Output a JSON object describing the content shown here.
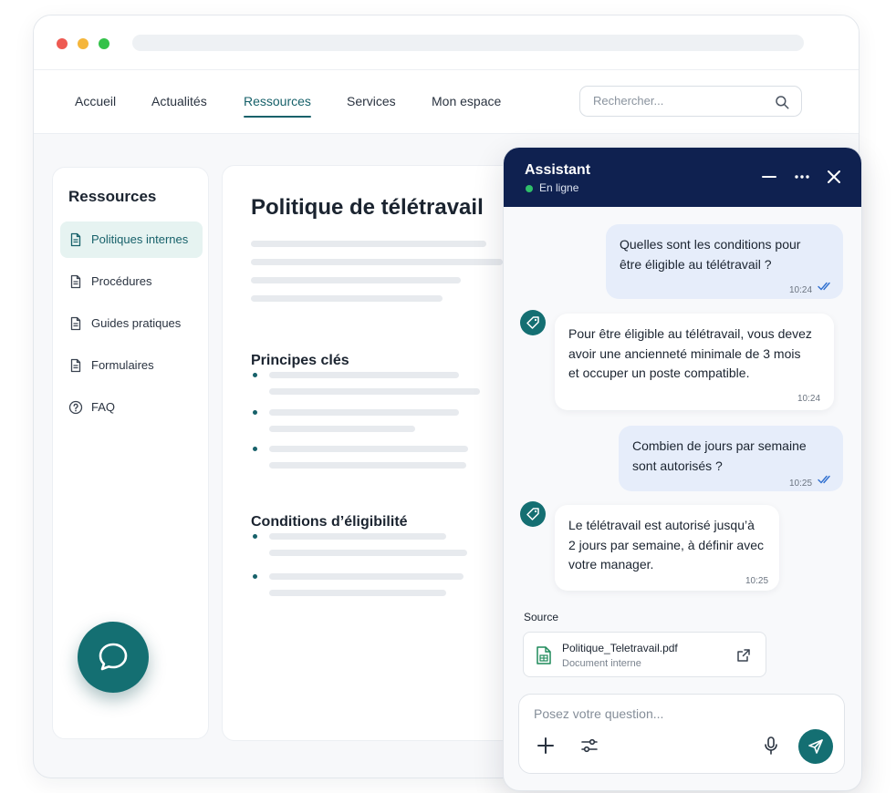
{
  "nav": {
    "items": [
      "Accueil",
      "Actualités",
      "Ressources",
      "Services",
      "Mon espace"
    ],
    "active": "Ressources",
    "search_placeholder": "Rechercher..."
  },
  "sidebar": {
    "title": "Ressources",
    "items": [
      {
        "label": "Politiques internes",
        "icon": "document-icon",
        "active": true
      },
      {
        "label": "Procédures",
        "icon": "document-icon"
      },
      {
        "label": "Guides pratiques",
        "icon": "document-icon"
      },
      {
        "label": "Formulaires",
        "icon": "document-icon"
      },
      {
        "label": "FAQ",
        "icon": "question-circle-icon"
      }
    ]
  },
  "article": {
    "title": "Politique de télétravail",
    "sections": [
      "Principes clés",
      "Conditions d’éligibilité"
    ]
  },
  "chat": {
    "title": "Assistant",
    "status": "En ligne",
    "messages": [
      {
        "role": "user",
        "lines": [
          "Quelles sont les conditions pour",
          "être éligible au télétravail ?"
        ],
        "time": "10:24"
      },
      {
        "role": "bot",
        "lines": [
          "Pour être éligible au télétravail, vous devez",
          "avoir une ancienneté minimale de 3 mois",
          "et occuper un poste compatible."
        ],
        "time": "10:24"
      },
      {
        "role": "user",
        "lines": [
          "Combien de jours par semaine",
          "sont autorisés ?"
        ],
        "time": "10:25"
      },
      {
        "role": "bot",
        "lines": [
          "Le télétravail est autorisé jusqu’à",
          "2 jours par semaine, à définir avec",
          "votre manager."
        ],
        "time": "10:25"
      }
    ],
    "source_label": "Source",
    "source": {
      "filename": "Politique_Teletravail.pdf",
      "subtitle": "Document interne"
    },
    "input_placeholder": "Posez votre question..."
  },
  "colors": {
    "accent": "#146f72",
    "header_bg": "#0f2150",
    "user_bubble": "#e6edfa",
    "online": "#2fbf6a"
  }
}
